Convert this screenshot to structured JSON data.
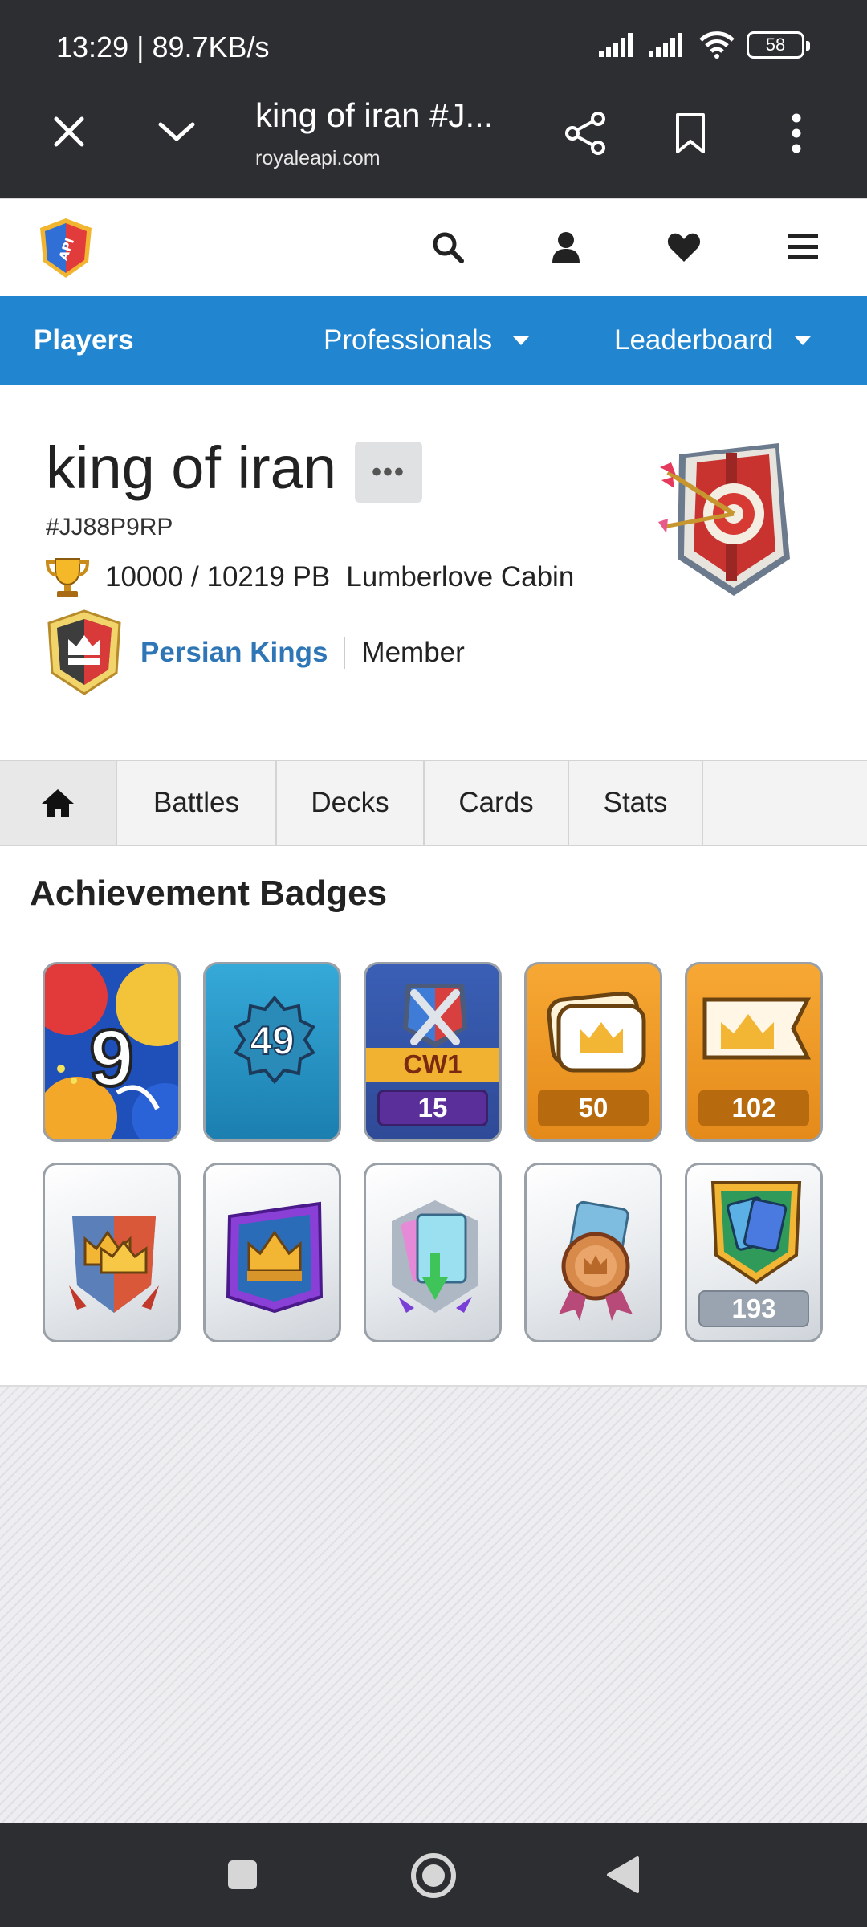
{
  "status": {
    "time": "13:29 | 89.7KB/s",
    "battery": "58"
  },
  "browser": {
    "title": "king of iran #J...",
    "url": "royaleapi.com"
  },
  "nav": {
    "players": "Players",
    "professionals": "Professionals",
    "leaderboard": "Leaderboard"
  },
  "player": {
    "name": "king of iran",
    "more": "•••",
    "tag": "#JJ88P9RP",
    "trophies": "10000 / 10219 PB",
    "arena": "Lumberlove Cabin",
    "clan": "Persian Kings",
    "role": "Member"
  },
  "tabs": {
    "battles": "Battles",
    "decks": "Decks",
    "cards": "Cards",
    "stats": "Stats"
  },
  "section_title": "Achievement Badges",
  "badges": {
    "years": "9",
    "level": "49",
    "cw_label": "CW1",
    "cw_value": "15",
    "crowns_value": "50",
    "banner_value": "102",
    "cards_value": "193"
  },
  "colors": {
    "nav_blue": "#2185d0",
    "clan_link": "#2f76b6",
    "chrome": "#2d2e31"
  }
}
